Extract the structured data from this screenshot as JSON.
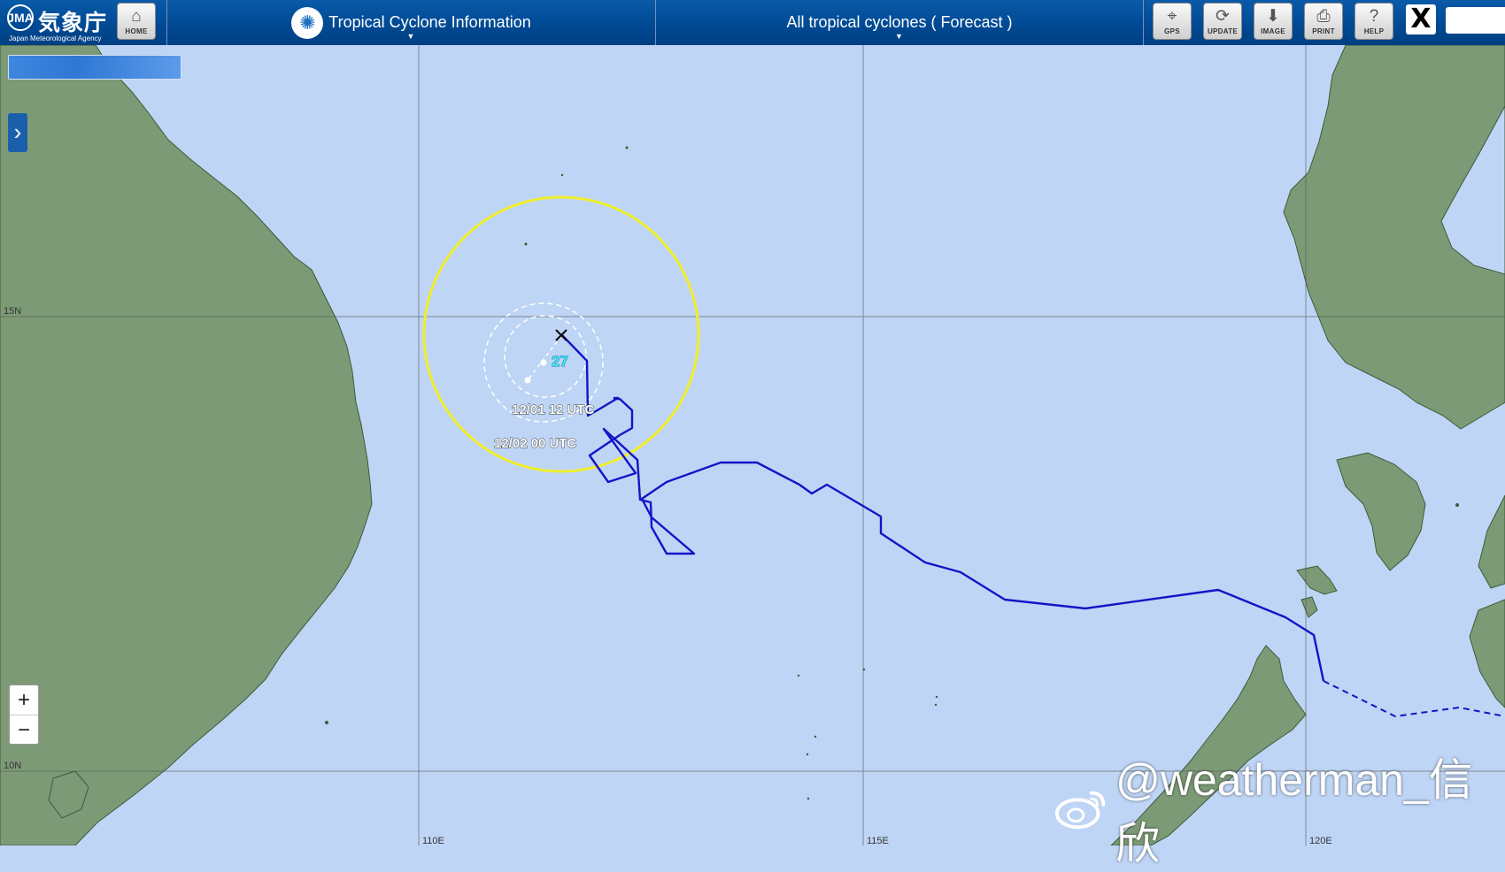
{
  "header": {
    "agency_name_ja": "気象庁",
    "agency_name_en": "Japan Meteorological Agency",
    "emblem": "JMA",
    "menu_title": "Tropical Cyclone Information",
    "menu_forecast": "All tropical cyclones ( Forecast )",
    "tools": [
      {
        "icon": "home-icon",
        "label": "HOME"
      },
      {
        "icon": "gps-icon",
        "label": "GPS"
      },
      {
        "icon": "update-icon",
        "label": "UPDATE"
      },
      {
        "icon": "image-icon",
        "label": "IMAGE"
      },
      {
        "icon": "print-icon",
        "label": "PRINT"
      },
      {
        "icon": "help-icon",
        "label": "HELP"
      }
    ],
    "x_label": "X"
  },
  "map": {
    "latitude_labels": [
      "15N",
      "10N"
    ],
    "longitude_labels": [
      "110E",
      "115E",
      "120E"
    ],
    "storm_number": "27",
    "time_labels": [
      "12/01 12 UTC",
      "12/02 00 UTC"
    ],
    "colors": {
      "sea": "#bfd5f5",
      "land": "#7d9a76",
      "track": "#1414c8",
      "storm_circle": "#f0ee2a",
      "forecast_circle": "#ffffff"
    }
  },
  "controls": {
    "zoom_in": "+",
    "zoom_out": "−",
    "side_toggle": "›"
  },
  "watermark": "@weatherman_信欣"
}
